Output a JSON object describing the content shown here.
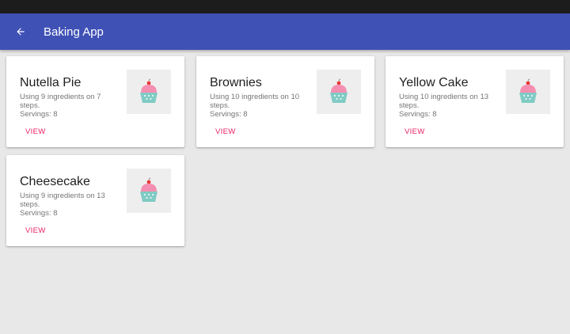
{
  "app_bar": {
    "title": "Baking App",
    "back_icon": "arrow-back-icon",
    "color": "#3f51b5"
  },
  "accent_color": "#e91e63",
  "recipes": [
    {
      "name": "Nutella Pie",
      "description": "Using 9 ingredients on 7 steps.",
      "servings": "Servings: 8",
      "action": "VIEW",
      "icon": "cupcake-icon"
    },
    {
      "name": "Brownies",
      "description": "Using 10 ingredients on 10 steps.",
      "servings": "Servings: 8",
      "action": "VIEW",
      "icon": "cupcake-icon"
    },
    {
      "name": "Yellow Cake",
      "description": "Using 10 ingredients on 13 steps.",
      "servings": "Servings: 8",
      "action": "VIEW",
      "icon": "cupcake-icon"
    },
    {
      "name": "Cheesecake",
      "description": "Using 9 ingredients on 13 steps.",
      "servings": "Servings: 8",
      "action": "VIEW",
      "icon": "cupcake-icon"
    }
  ]
}
